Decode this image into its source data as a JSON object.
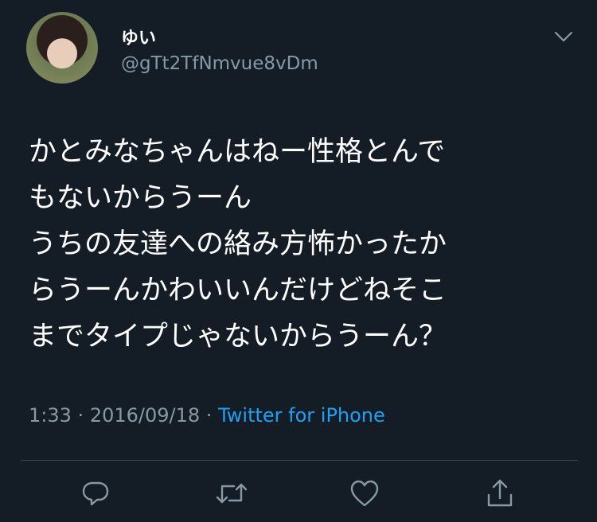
{
  "tweet": {
    "display_name": "ゆい",
    "handle": "@gTt2TfNmvue8vDm",
    "text_lines": [
      "かとみなちゃんはねー性格とんで",
      "もないからうーん",
      "うちの友達への絡み方怖かったか",
      "らうーんかわいいんだけどねそこ",
      "までタイプじゃないからうーん？"
    ],
    "time": "1:33",
    "date": "2016/09/18",
    "separator": "·",
    "source": "Twitter for iPhone"
  },
  "icons": {
    "menu": "chevron-down-icon",
    "reply": "reply-icon",
    "retweet": "retweet-icon",
    "like": "heart-icon",
    "share": "share-icon"
  },
  "colors": {
    "background": "#141d26",
    "secondary_text": "#8899a6",
    "link": "#1da1f2",
    "divider": "#38444d"
  }
}
